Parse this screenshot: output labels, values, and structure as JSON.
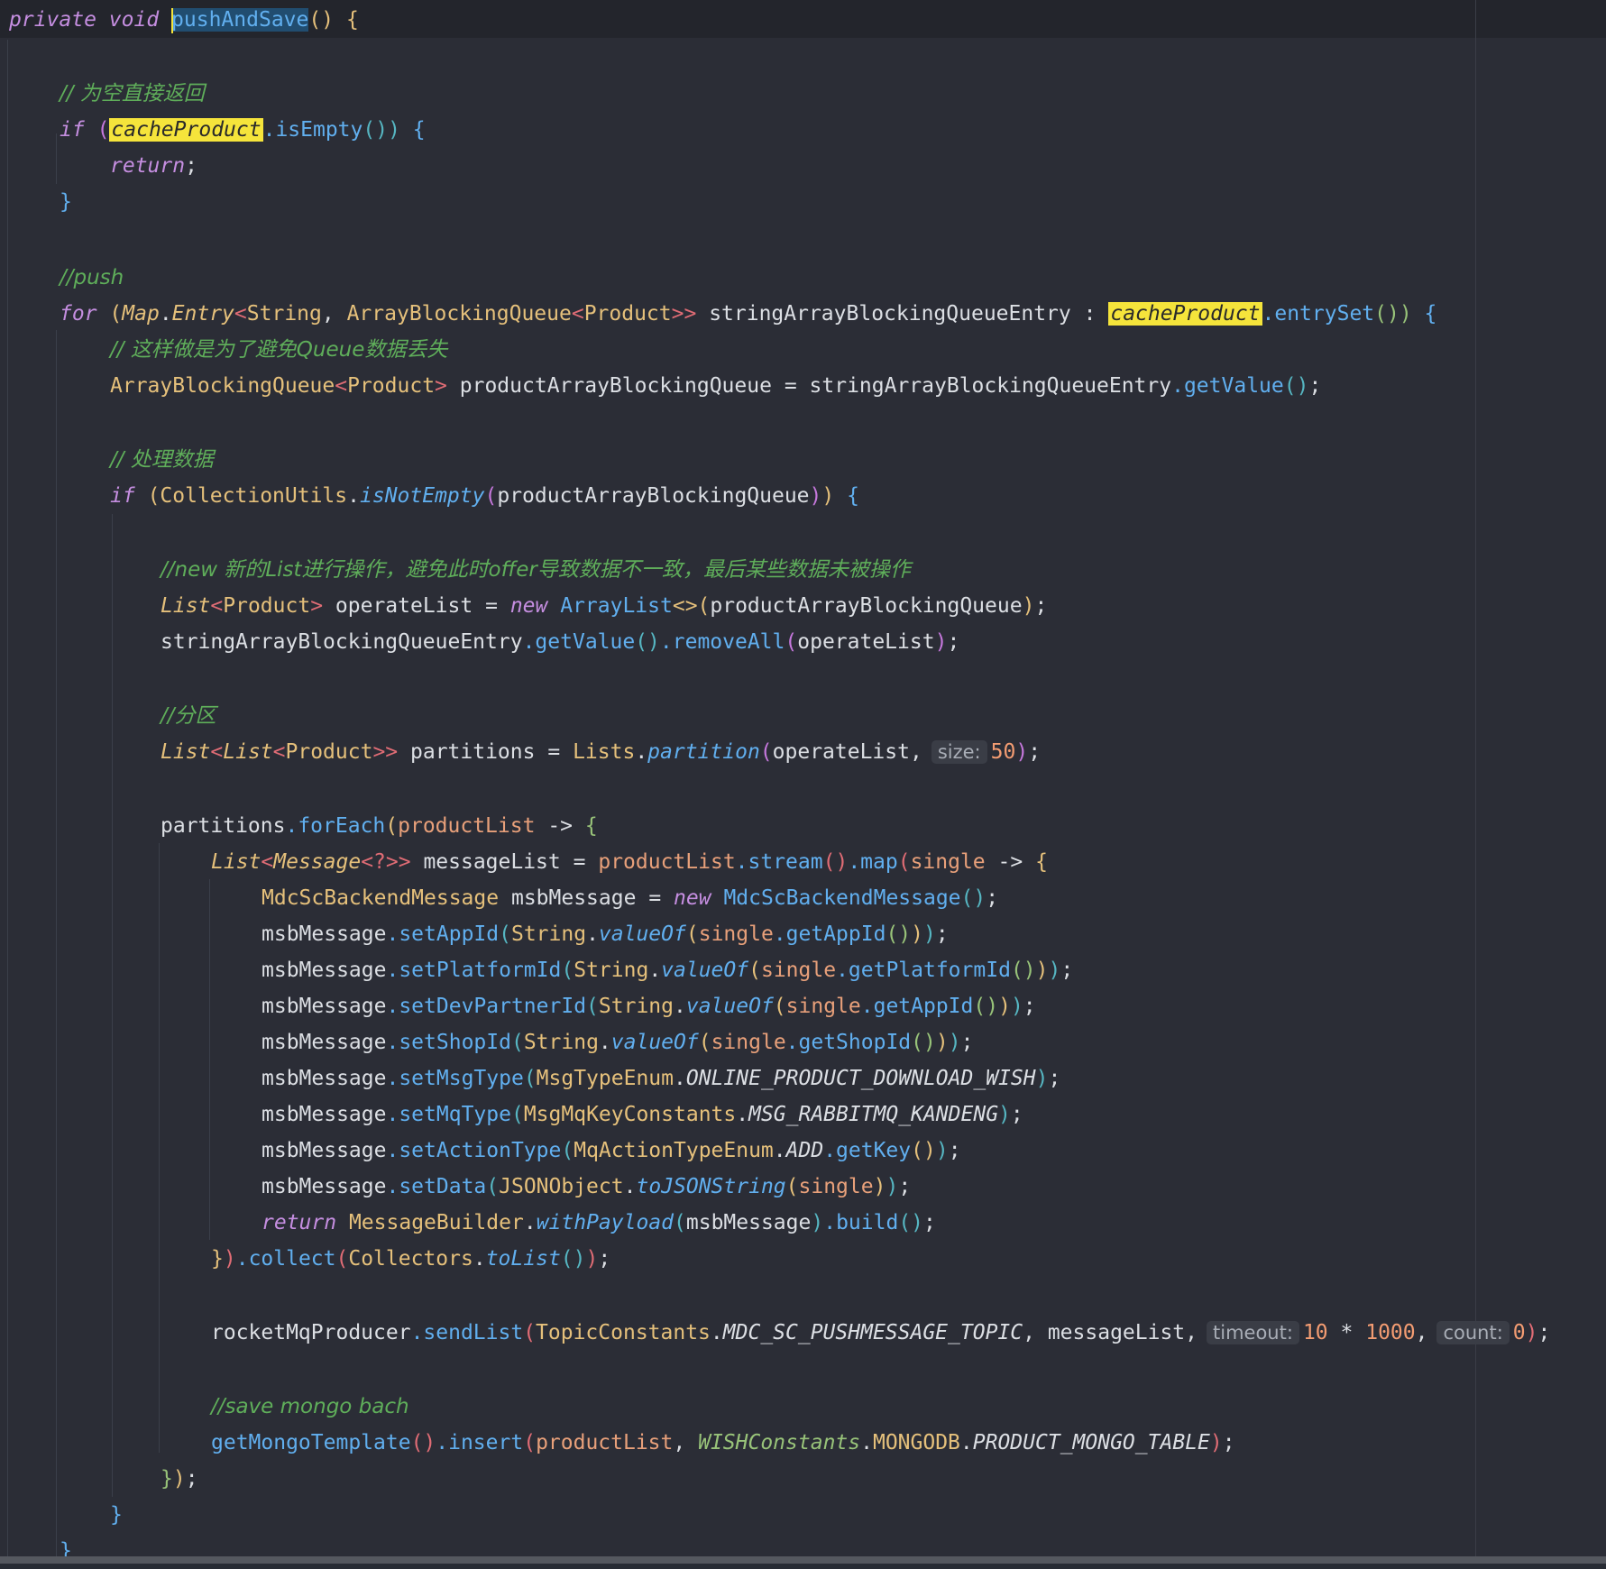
{
  "code": {
    "l1_kw1": "private",
    "l1_kw2": "void",
    "l1_method": "pushAndSave",
    "l1_rest": "()",
    "l1_brace": "{",
    "l3_comment": "// 为空直接返回",
    "l4_if": "if",
    "l4_var": "cacheProduct",
    "l4_call": ".isEmpty",
    "l4_rest": "())",
    "l5_return": "return",
    "l7_comment": "//push",
    "l8_for": "for",
    "l8_map": "Map",
    "l8_entry": "Entry",
    "l8_string": "String",
    "l8_abq": "ArrayBlockingQueue",
    "l8_product": "Product",
    "l8_entryvar": "stringArrayBlockingQueueEntry",
    "l8_cache": "cacheProduct",
    "l8_entryset": ".entrySet",
    "l9_comment": "// 这样做是为了避免Queue数据丢失",
    "l10_type": "ArrayBlockingQueue",
    "l10_product": "Product",
    "l10_var": "productArrayBlockingQueue",
    "l10_entry": "stringArrayBlockingQueueEntry",
    "l10_getvalue": ".getValue",
    "l12_comment": "// 处理数据",
    "l13_if": "if",
    "l13_utils": "CollectionUtils",
    "l13_method": "isNotEmpty",
    "l13_arg": "productArrayBlockingQueue",
    "l15_comment": "//new 新的List进行操作，避免此时offer导致数据不一致，最后某些数据未被操作",
    "l16_list": "List",
    "l16_product": "Product",
    "l16_var": "operateList",
    "l16_new": "new",
    "l16_arraylist": "ArrayList",
    "l16_arg": "productArrayBlockingQueue",
    "l17_entry": "stringArrayBlockingQueueEntry",
    "l17_getvalue": ".getValue",
    "l17_removeall": ".removeAll",
    "l17_arg": "operateList",
    "l19_comment": "//分区",
    "l20_list": "List",
    "l20_list2": "List",
    "l20_product": "Product",
    "l20_var": "partitions",
    "l20_lists": "Lists",
    "l20_partition": "partition",
    "l20_arg": "operateList",
    "l20_hint": "size:",
    "l20_num": "50",
    "l22_var": "partitions",
    "l22_foreach": ".forEach",
    "l22_param": "productList",
    "l23_list": "List",
    "l23_message": "Message",
    "l23_var": "messageList",
    "l23_pl": "productList",
    "l23_stream": ".stream",
    "l23_map": ".map",
    "l23_single": "single",
    "l24_type": "MdcScBackendMessage",
    "l24_var": "msbMessage",
    "l24_new": "new",
    "l24_type2": "MdcScBackendMessage",
    "msb": "msbMessage",
    "string": "String",
    "valueof": "valueOf",
    "single": "single",
    "l25_set": ".setAppId",
    "l25_get": ".getAppId",
    "l26_set": ".setPlatformId",
    "l26_get": ".getPlatformId",
    "l27_set": ".setDevPartnerId",
    "l27_get": ".getAppId",
    "l28_set": ".setShopId",
    "l28_get": ".getShopId",
    "l29_set": ".setMsgType",
    "l29_enum": "MsgTypeEnum",
    "l29_const": "ONLINE_PRODUCT_DOWNLOAD_WISH",
    "l30_set": ".setMqType",
    "l30_class": "MsgMqKeyConstants",
    "l30_const": "MSG_RABBITMQ_KANDENG",
    "l31_set": ".setActionType",
    "l31_enum": "MqActionTypeEnum",
    "l31_const": "ADD",
    "l31_getkey": ".getKey",
    "l32_set": ".setData",
    "l32_class": "JSONObject",
    "l32_method": "toJSONString",
    "l33_return": "return",
    "l33_builder": "MessageBuilder",
    "l33_with": "withPayload",
    "l33_build": ".build",
    "l34_collect": ".collect",
    "l34_collectors": "Collectors",
    "l34_tolist": "toList",
    "l36_var": "rocketMqProducer",
    "l36_send": ".sendList",
    "l36_class": "TopicConstants",
    "l36_const": "MDC_SC_PUSHMESSAGE_TOPIC",
    "l36_arg": "messageList",
    "l36_hint1": "timeout:",
    "l36_num1": "10",
    "l36_num2": "1000",
    "l36_hint2": "count:",
    "l36_num3": "0",
    "l38_comment": "//save mongo bach",
    "l39_get": "getMongoTemplate",
    "l39_insert": ".insert",
    "l39_arg": "productList",
    "l39_class": "WISHConstants",
    "l39_mongo": "MONGODB",
    "l39_const": "PRODUCT_MONGO_TABLE"
  },
  "colors": {
    "background": "#2b2d36",
    "keyword": "#c58ee0",
    "comment": "#5fae5a",
    "type": "#e5c07b",
    "function": "#61afef",
    "number": "#f39c72",
    "highlight": "#f5e43b"
  }
}
